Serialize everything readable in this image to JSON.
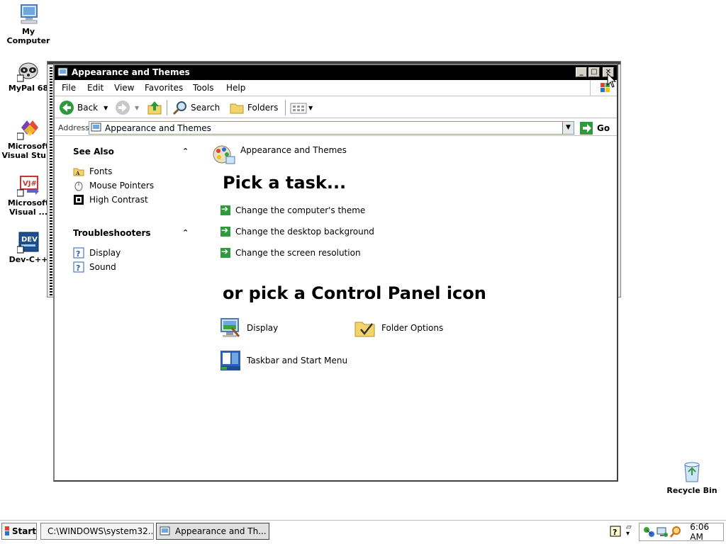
{
  "desktop": {
    "icons": [
      {
        "label": "My Computer",
        "icon": "computer-icon"
      },
      {
        "label": "MyPal 68",
        "icon": "raccoon-icon"
      },
      {
        "label": "Microsoft\nVisual Stu...",
        "icon": "visual-studio-icon"
      },
      {
        "label": "Microsoft\nVisual ...",
        "icon": "visual-jsharp-icon"
      },
      {
        "label": "Dev-C++",
        "icon": "devcpp-icon"
      }
    ],
    "recycle_bin": "Recycle Bin"
  },
  "window": {
    "title": "Appearance and Themes",
    "minimize_glyph": "_",
    "maximize_glyph": "□",
    "close_glyph": "✕",
    "menu": [
      "File",
      "Edit",
      "View",
      "Favorites",
      "Tools",
      "Help"
    ],
    "toolbar": {
      "back": "Back",
      "search": "Search",
      "folders": "Folders"
    },
    "address": {
      "label": "Address",
      "value": "Appearance and Themes",
      "go": "Go"
    },
    "sidebar": {
      "see_also": {
        "title": "See Also",
        "items": [
          "Fonts",
          "Mouse Pointers",
          "High Contrast"
        ]
      },
      "troubleshooters": {
        "title": "Troubleshooters",
        "items": [
          "Display",
          "Sound"
        ]
      },
      "collapse_glyph": "⌃"
    },
    "content": {
      "breadcrumb": "Appearance and Themes",
      "pick_task_heading": "Pick a task...",
      "tasks": [
        "Change the computer's theme",
        "Change the desktop background",
        "Change the screen resolution"
      ],
      "pick_icon_heading": "or pick a Control Panel icon",
      "icons": [
        "Display",
        "Folder Options",
        "Taskbar and Start Menu"
      ]
    }
  },
  "taskbar": {
    "start": "Start",
    "buttons": [
      "C:\\WINDOWS\\system32...",
      "Appearance and Th..."
    ],
    "clock": "6:06 AM"
  },
  "colors": {
    "title_bar": "#000000",
    "task_arrow": "#2f9a3c"
  }
}
